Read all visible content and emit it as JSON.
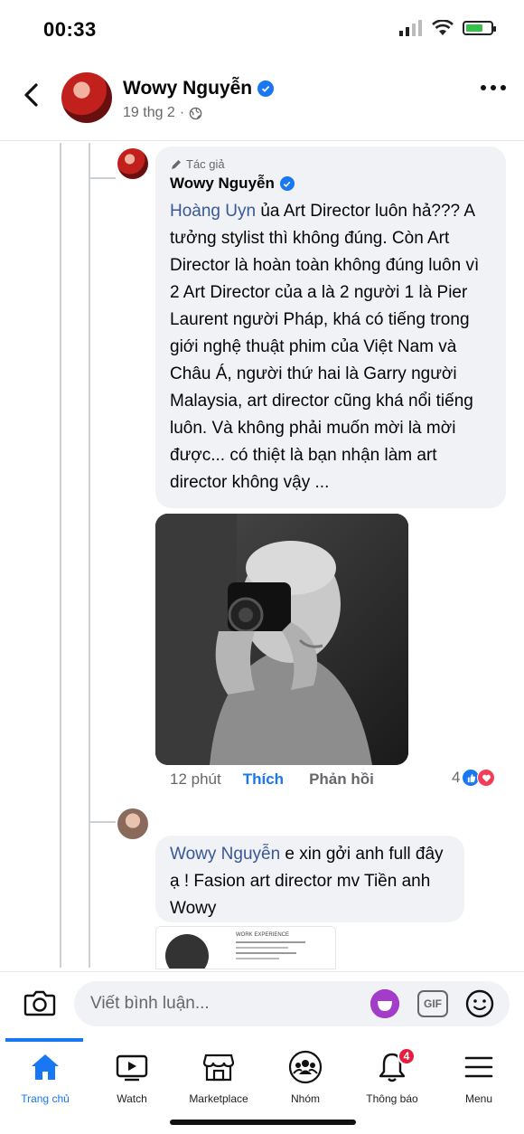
{
  "status_bar": {
    "time": "00:33"
  },
  "post_header": {
    "author": "Wowy Nguyễn",
    "date": "19 thg 2",
    "date_separator": "·"
  },
  "comment_main": {
    "author_tag": "Tác giả",
    "author": "Wowy Nguyễn",
    "mention": "Hoàng Uyn",
    "text": " ủa Art Director luôn hả??? A tưởng stylist thì không đúng. Còn Art Director là hoàn toàn không đúng luôn vì 2 Art Director của a là 2 người 1 là Pier Laurent người Pháp, khá có tiếng trong giới nghệ thuật phim của Việt Nam và Châu Á, người thứ hai là Garry người Malaysia, art director cũng khá nổi tiếng luôn. Và không phải muốn mời là mời được... có thiệt là bạn nhận làm art director không vậy ..."
  },
  "comment_actions": {
    "time": "12 phút",
    "like": "Thích",
    "reply": "Phản hồi",
    "reaction_count": "4"
  },
  "comment_reply": {
    "mention": "Wowy Nguyễn",
    "text": " e xin gởi anh full đây ạ ! Fasion art director mv Tiền anh Wowy"
  },
  "attachment_preview": {
    "heading": "WORK EXPERIENCE"
  },
  "composer": {
    "placeholder": "Viết bình luận...",
    "gif_label": "GIF"
  },
  "tab_bar": {
    "tabs": [
      {
        "label": "Trang chủ",
        "icon": "home-icon"
      },
      {
        "label": "Watch",
        "icon": "watch-icon"
      },
      {
        "label": "Marketplace",
        "icon": "marketplace-icon"
      },
      {
        "label": "Nhóm",
        "icon": "groups-icon"
      },
      {
        "label": "Thông báo",
        "icon": "bell-icon",
        "badge": "4"
      },
      {
        "label": "Menu",
        "icon": "menu-icon"
      }
    ]
  },
  "colors": {
    "accent": "#1877f2",
    "mention": "#385898",
    "bubble": "#f0f2f5",
    "badge": "#e41e3f"
  }
}
